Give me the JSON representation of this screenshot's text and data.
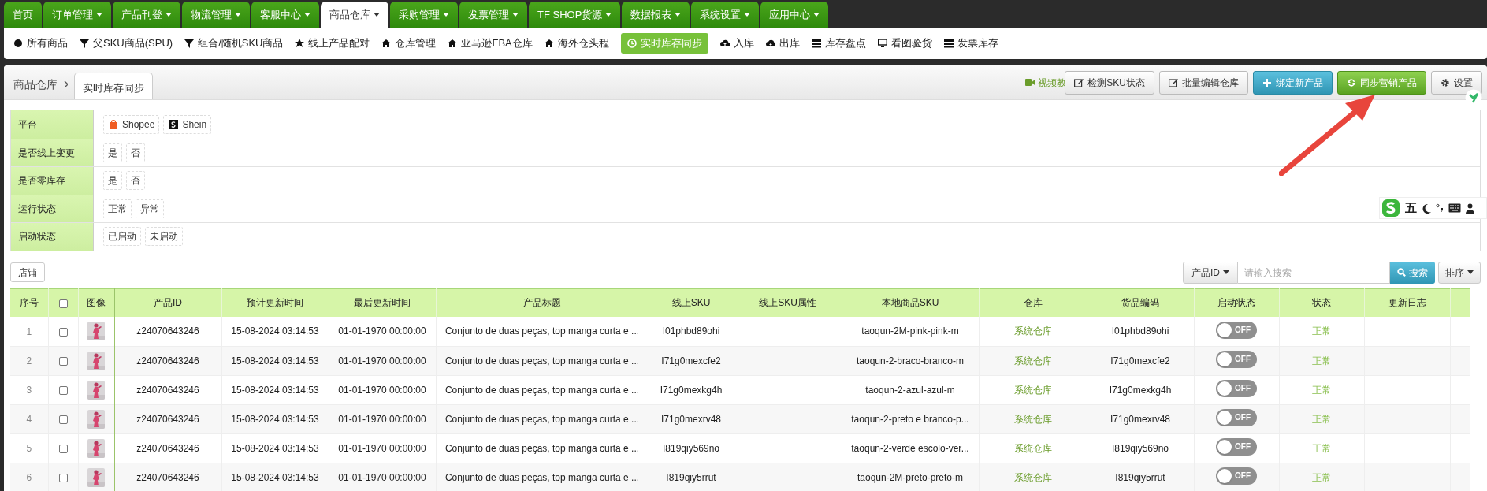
{
  "top_nav": [
    {
      "label": "首页",
      "dropdown": false,
      "selected": false
    },
    {
      "label": "订单管理",
      "dropdown": true,
      "selected": false
    },
    {
      "label": "产品刊登",
      "dropdown": true,
      "selected": false
    },
    {
      "label": "物流管理",
      "dropdown": true,
      "selected": false
    },
    {
      "label": "客服中心",
      "dropdown": true,
      "selected": false
    },
    {
      "label": "商品仓库",
      "dropdown": true,
      "selected": true
    },
    {
      "label": "采购管理",
      "dropdown": true,
      "selected": false
    },
    {
      "label": "发票管理",
      "dropdown": true,
      "selected": false
    },
    {
      "label": "TF SHOP货源",
      "dropdown": true,
      "selected": false
    },
    {
      "label": "数据报表",
      "dropdown": true,
      "selected": false
    },
    {
      "label": "系统设置",
      "dropdown": true,
      "selected": false
    },
    {
      "label": "应用中心",
      "dropdown": true,
      "selected": false
    }
  ],
  "sub_nav": [
    {
      "label": "所有商品",
      "selected": false
    },
    {
      "label": "父SKU商品(SPU)",
      "selected": false
    },
    {
      "label": "组合/随机SKU商品",
      "selected": false
    },
    {
      "label": "线上产品配对",
      "selected": false
    },
    {
      "label": "仓库管理",
      "selected": false
    },
    {
      "label": "亚马逊FBA仓库",
      "selected": false
    },
    {
      "label": "海外仓头程",
      "selected": false
    },
    {
      "label": "实时库存同步",
      "selected": true
    },
    {
      "label": "入库",
      "selected": false
    },
    {
      "label": "出库",
      "selected": false
    },
    {
      "label": "库存盘点",
      "selected": false
    },
    {
      "label": "看图验货",
      "selected": false
    },
    {
      "label": "发票库存",
      "selected": false
    }
  ],
  "breadcrumb": [
    "商品仓库",
    "实时库存同步"
  ],
  "toolbar": {
    "video_link": "视频教",
    "buttons": [
      {
        "label": "检测SKU状态",
        "kind": "default"
      },
      {
        "label": "批量编辑仓库",
        "kind": "default"
      },
      {
        "label": "绑定新产品",
        "kind": "info"
      },
      {
        "label": "同步营销产品",
        "kind": "success"
      },
      {
        "label": "设置",
        "kind": "settings"
      }
    ]
  },
  "filters": [
    {
      "label": "平台",
      "options": [
        {
          "label": "Shopee",
          "kind": "shopee"
        },
        {
          "label": "Shein",
          "kind": "shein"
        }
      ]
    },
    {
      "label": "是否线上变更",
      "options": [
        {
          "label": "是"
        },
        {
          "label": "否"
        }
      ]
    },
    {
      "label": "是否零库存",
      "options": [
        {
          "label": "是"
        },
        {
          "label": "否"
        }
      ]
    },
    {
      "label": "运行状态",
      "options": [
        {
          "label": "正常"
        },
        {
          "label": "异常"
        }
      ]
    },
    {
      "label": "启动状态",
      "options": [
        {
          "label": "已启动"
        },
        {
          "label": "未启动"
        }
      ]
    }
  ],
  "store_button": "店铺",
  "search": {
    "field_select": "产品ID",
    "placeholder": "请输入搜索",
    "button": "搜索",
    "sort": "排序"
  },
  "ime_toolbar": {
    "mode": "五"
  },
  "table": {
    "columns": [
      "序号",
      "",
      "图像",
      "产品ID",
      "预计更新时间",
      "最后更新时间",
      "产品标题",
      "线上SKU",
      "线上SKU属性",
      "本地商品SKU",
      "仓库",
      "货品编码",
      "启动状态",
      "状态",
      "更新日志"
    ],
    "header_checked": false,
    "rows": [
      {
        "index": "1",
        "checked": false,
        "product_id": "z24070643246",
        "planned": "15-08-2024 03:14:53",
        "last": "01-01-1970 00:00:00",
        "title": "Conjunto de duas peças, top manga curta e ...",
        "online_sku": "I01phbd89ohi",
        "local_sku": "taoqun-2M-pink-pink-m",
        "warehouse": "系统仓库",
        "code": "I01phbd89ohi",
        "on": false,
        "switch_text": "OFF",
        "status": "正常"
      },
      {
        "index": "2",
        "checked": false,
        "product_id": "z24070643246",
        "planned": "15-08-2024 03:14:53",
        "last": "01-01-1970 00:00:00",
        "title": "Conjunto de duas peças, top manga curta e ...",
        "online_sku": "I71g0mexcfe2",
        "local_sku": "taoqun-2-braco-branco-m",
        "warehouse": "系统仓库",
        "code": "I71g0mexcfe2",
        "on": false,
        "switch_text": "OFF",
        "status": "正常"
      },
      {
        "index": "3",
        "checked": false,
        "product_id": "z24070643246",
        "planned": "15-08-2024 03:14:53",
        "last": "01-01-1970 00:00:00",
        "title": "Conjunto de duas peças, top manga curta e ...",
        "online_sku": "I71g0mexkg4h",
        "local_sku": "taoqun-2-azul-azul-m",
        "warehouse": "系统仓库",
        "code": "I71g0mexkg4h",
        "on": false,
        "switch_text": "OFF",
        "status": "正常"
      },
      {
        "index": "4",
        "checked": false,
        "product_id": "z24070643246",
        "planned": "15-08-2024 03:14:53",
        "last": "01-01-1970 00:00:00",
        "title": "Conjunto de duas peças, top manga curta e ...",
        "online_sku": "I71g0mexrv48",
        "local_sku": "taoqun-2-preto e branco-p...",
        "warehouse": "系统仓库",
        "code": "I71g0mexrv48",
        "on": false,
        "switch_text": "OFF",
        "status": "正常"
      },
      {
        "index": "5",
        "checked": false,
        "product_id": "z24070643246",
        "planned": "15-08-2024 03:14:53",
        "last": "01-01-1970 00:00:00",
        "title": "Conjunto de duas peças, top manga curta e ...",
        "online_sku": "I819qiy569no",
        "local_sku": "taoqun-2-verde escolo-ver...",
        "warehouse": "系统仓库",
        "code": "I819qiy569no",
        "on": false,
        "switch_text": "OFF",
        "status": "正常"
      },
      {
        "index": "6",
        "checked": false,
        "product_id": "z24070643246",
        "planned": "15-08-2024 03:14:53",
        "last": "01-01-1970 00:00:00",
        "title": "Conjunto de duas peças, top manga curta e ...",
        "online_sku": "I819qiy5rrut",
        "local_sku": "taoqun-2M-preto-preto-m",
        "warehouse": "系统仓库",
        "code": "I819qiy5rrut",
        "on": false,
        "switch_text": "OFF",
        "status": "正常"
      }
    ]
  }
}
